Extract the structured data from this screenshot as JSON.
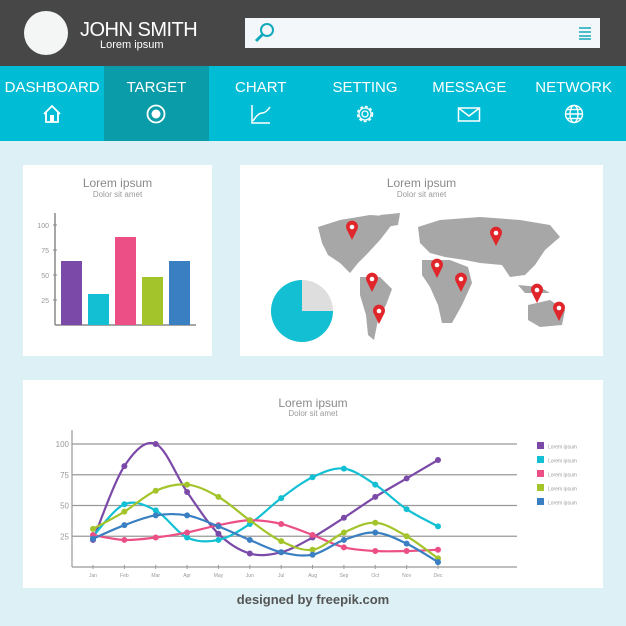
{
  "header": {
    "name": "JOHN SMITH",
    "subtitle": "Lorem ipsum",
    "search_placeholder": ""
  },
  "nav": [
    {
      "label": "DASHBOARD",
      "icon": "home-icon"
    },
    {
      "label": "TARGET",
      "icon": "target-icon",
      "active": true
    },
    {
      "label": "CHART",
      "icon": "chart-icon"
    },
    {
      "label": "SETTING",
      "icon": "gear-icon"
    },
    {
      "label": "MESSAGE",
      "icon": "envelope-icon"
    },
    {
      "label": "NETWORK",
      "icon": "globe-icon"
    }
  ],
  "colors": {
    "accent": "#00bcd4",
    "active": "#0a9ca8",
    "header": "#474747",
    "purple": "#7b4aa8",
    "cyan": "#13c0d3",
    "pink": "#ec4f86",
    "green": "#a3c42a",
    "blue": "#3a7fc1",
    "pin": "#e0262b",
    "map": "#a7a7a7"
  },
  "bar_card": {
    "title": "Lorem ipsum",
    "subtitle": "Dolor sit amet"
  },
  "map_card": {
    "title": "Lorem ipsum",
    "subtitle": "Dolor sit amet",
    "pins": 8
  },
  "line_card": {
    "title": "Lorem ipsum",
    "subtitle": "Dolor sit amet"
  },
  "chart_data": [
    {
      "type": "bar",
      "categories": [
        "",
        "",
        "",
        "",
        ""
      ],
      "values": [
        64,
        31,
        88,
        48,
        64
      ],
      "colors": [
        "#7b4aa8",
        "#13c0d3",
        "#ec4f86",
        "#a3c42a",
        "#3a7fc1"
      ],
      "yticks": [
        "25",
        "50",
        "75",
        "100"
      ],
      "ylim": [
        0,
        110
      ],
      "title": "Lorem ipsum",
      "subtitle": "Dolor sit amet"
    },
    {
      "type": "pie",
      "values": [
        75,
        25
      ],
      "colors": [
        "#13c0d3",
        "#dedede"
      ]
    },
    {
      "type": "line",
      "x": [
        "Jan",
        "Feb",
        "Mar",
        "Apr",
        "May",
        "Jun",
        "Jul",
        "Aug",
        "Sep",
        "Oct",
        "Nov",
        "Dec"
      ],
      "yticks": [
        "25",
        "50",
        "75",
        "100"
      ],
      "ylim": [
        0,
        110
      ],
      "grid": true,
      "legend": "right",
      "series": [
        {
          "name": "Lorem ipsum",
          "color": "#7b4aa8",
          "values": [
            22,
            82,
            100,
            61,
            27,
            11,
            12,
            24,
            40,
            57,
            72,
            87
          ]
        },
        {
          "name": "Lorem ipsum",
          "color": "#13c0d3",
          "values": [
            25,
            51,
            46,
            24,
            22,
            35,
            56,
            73,
            80,
            67,
            47,
            33
          ]
        },
        {
          "name": "Lorem ipsum",
          "color": "#ec4f86",
          "values": [
            26,
            22,
            24,
            28,
            34,
            38,
            35,
            26,
            16,
            13,
            13,
            14
          ]
        },
        {
          "name": "Lorem ipsum",
          "color": "#a3c42a",
          "values": [
            31,
            45,
            62,
            67,
            57,
            38,
            21,
            14,
            28,
            36,
            25,
            7
          ]
        },
        {
          "name": "Lorem ipsum",
          "color": "#3a7fc1",
          "values": [
            23,
            34,
            42,
            42,
            33,
            22,
            12,
            10,
            22,
            28,
            19,
            4
          ]
        }
      ]
    }
  ],
  "footer": {
    "text": "designed by freepik.com"
  }
}
